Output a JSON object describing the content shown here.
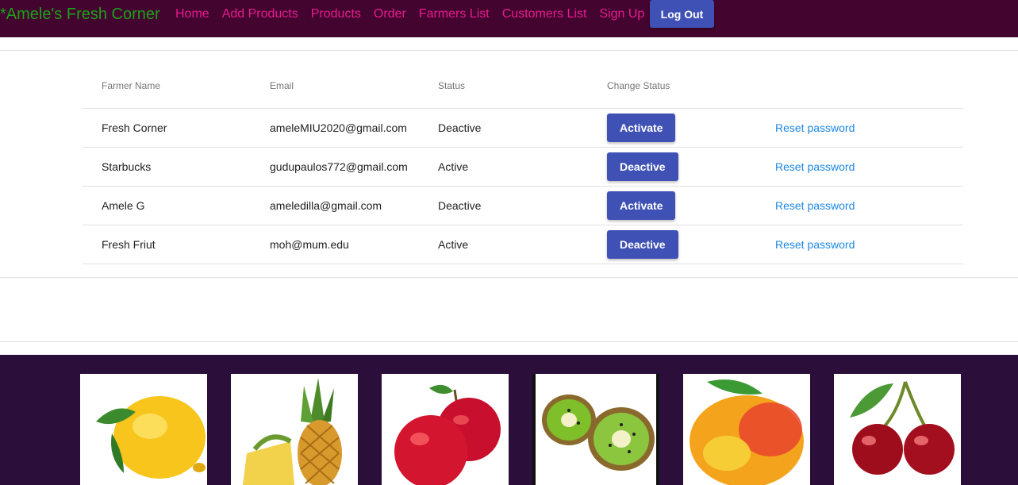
{
  "brand": "*Amele's Fresh Corner",
  "nav": {
    "items": [
      {
        "label": "Home",
        "key": "home"
      },
      {
        "label": "Add Products",
        "key": "add-products"
      },
      {
        "label": "Products",
        "key": "products"
      },
      {
        "label": "Order",
        "key": "order"
      },
      {
        "label": "Farmers List",
        "key": "farmers-list"
      },
      {
        "label": "Customers List",
        "key": "customers-list"
      },
      {
        "label": "Sign Up",
        "key": "sign-up"
      }
    ],
    "logout_label": "Log Out"
  },
  "table": {
    "headers": [
      "Farmer Name",
      "Email",
      "Status",
      "Change Status"
    ],
    "rows": [
      {
        "name": "Fresh Corner",
        "email": "ameleMIU2020@gmail.com",
        "status": "Deactive",
        "action": "Activate",
        "reset": "Reset password"
      },
      {
        "name": "Starbucks",
        "email": "gudupaulos772@gmail.com",
        "status": "Active",
        "action": "Deactive",
        "reset": "Reset password"
      },
      {
        "name": "Amele G",
        "email": "ameledilla@gmail.com",
        "status": "Deactive",
        "action": "Activate",
        "reset": "Reset password"
      },
      {
        "name": "Fresh Friut",
        "email": "moh@mum.edu",
        "status": "Active",
        "action": "Deactive",
        "reset": "Reset password"
      }
    ]
  },
  "footer": {
    "images": [
      {
        "icon": "lemon-icon"
      },
      {
        "icon": "pineapple-icon"
      },
      {
        "icon": "apple-icon"
      },
      {
        "icon": "kiwi-icon"
      },
      {
        "icon": "mango-icon"
      },
      {
        "icon": "cherry-icon"
      }
    ]
  },
  "colors": {
    "navbar": "#43052f",
    "brand": "#1aa11a",
    "nav_link": "#e8198f",
    "button": "#3f51b5",
    "link": "#1e88e5",
    "footer": "#2b0f3a"
  }
}
